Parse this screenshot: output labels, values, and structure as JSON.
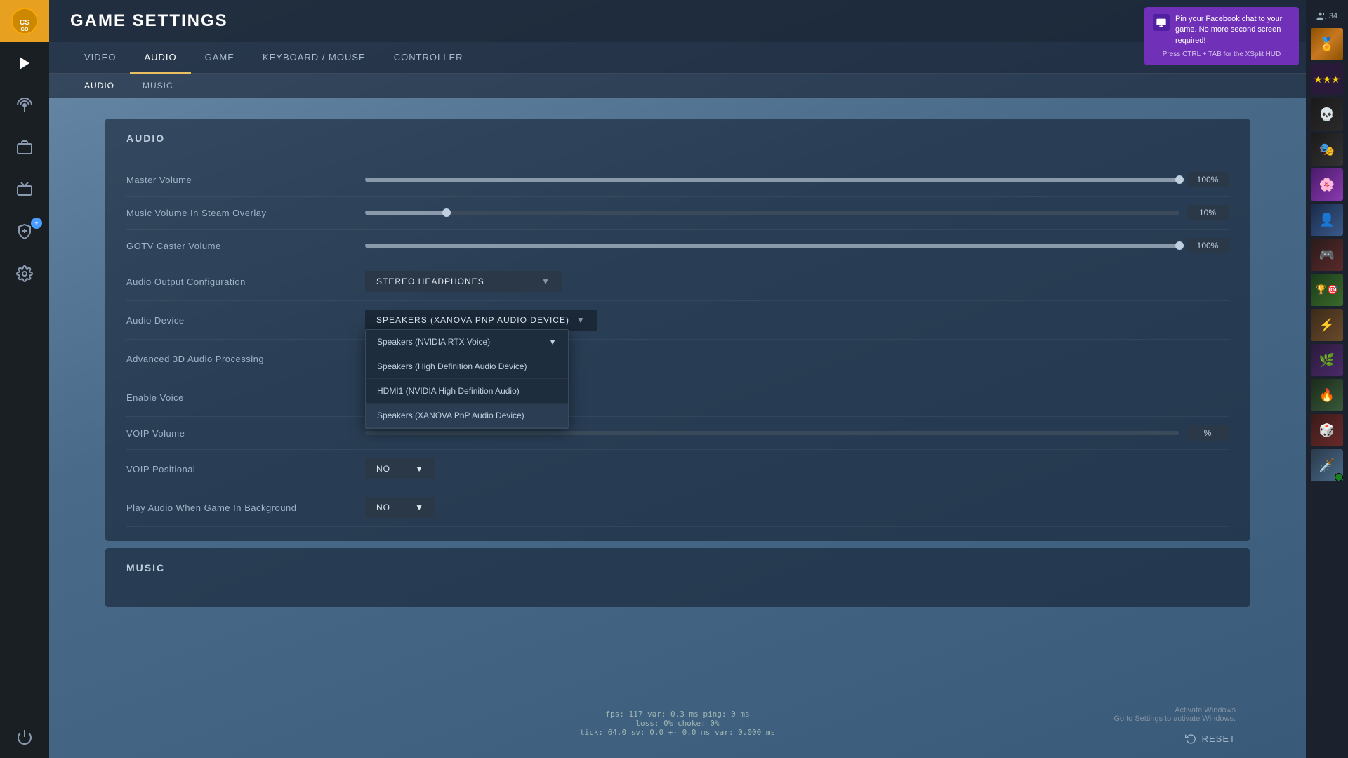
{
  "app": {
    "title": "GAME SETTINGS",
    "logo_text": "CS:GO"
  },
  "nav_tabs": [
    {
      "label": "Video",
      "active": false
    },
    {
      "label": "Audio",
      "active": true
    },
    {
      "label": "Game",
      "active": false
    },
    {
      "label": "Keyboard / Mouse",
      "active": false
    },
    {
      "label": "Controller",
      "active": false
    }
  ],
  "sub_tabs": [
    {
      "label": "Audio",
      "active": true
    },
    {
      "label": "Music",
      "active": false
    }
  ],
  "audio_section": {
    "title": "Audio",
    "settings": [
      {
        "label": "Master Volume",
        "type": "slider",
        "value": "100%",
        "fill_percent": 100
      },
      {
        "label": "Music Volume In Steam Overlay",
        "type": "slider",
        "value": "10%",
        "fill_percent": 10
      },
      {
        "label": "GOTV Caster Volume",
        "type": "slider",
        "value": "100%",
        "fill_percent": 100
      },
      {
        "label": "Audio Output Configuration",
        "type": "dropdown",
        "value": "STEREO HEADPHONES"
      },
      {
        "label": "Audio Device",
        "type": "dropdown",
        "value": "SPEAKERS (XANOVA PNP AUDIO DEVICE)",
        "open": true
      },
      {
        "label": "Advanced 3D Audio Processing",
        "type": "dropdown_inline",
        "value": ""
      },
      {
        "label": "Enable Voice",
        "type": "dropdown_inline",
        "value": ""
      },
      {
        "label": "VOIP Volume",
        "type": "slider_percent",
        "value": "%"
      },
      {
        "label": "VOIP Positional",
        "type": "select",
        "value": "NO"
      },
      {
        "label": "Play Audio When Game In Background",
        "type": "select",
        "value": "NO"
      }
    ]
  },
  "audio_device_dropdown": {
    "options": [
      {
        "label": "Speakers (NVIDIA RTX Voice)",
        "has_arrow": true
      },
      {
        "label": "Speakers (High Definition Audio Device)",
        "has_arrow": false
      },
      {
        "label": "HDMI1 (NVIDIA High Definition Audio)",
        "has_arrow": false
      },
      {
        "label": "Speakers (XANOVA PnP Audio Device)",
        "has_arrow": false
      }
    ]
  },
  "music_section": {
    "title": "Music"
  },
  "debug": {
    "line1": "fps: 117 var: 0.3 ms  ping: 0 ms",
    "line2": "loss:  0%  choke:  0%",
    "line3": "tick: 64.0  sv: 0.0 +-  0.0 ms  var: 0.000 ms"
  },
  "reset_button": {
    "label": "RESET"
  },
  "notification": {
    "title": "Pin your Facebook chat to your game. No more second screen required!",
    "footer": "Press CTRL + TAB for the XSplit HUD"
  },
  "activate_windows": {
    "line1": "Activate Windows",
    "line2": "Go to Settings to activate Windows."
  },
  "sidebar_icons": [
    {
      "name": "play-icon",
      "symbol": "▶"
    },
    {
      "name": "antenna-icon",
      "symbol": "📡"
    },
    {
      "name": "briefcase-icon",
      "symbol": "💼"
    },
    {
      "name": "tv-icon",
      "symbol": "📺"
    },
    {
      "name": "shield-plus-icon",
      "symbol": "🛡"
    },
    {
      "name": "settings-icon",
      "symbol": "⚙"
    },
    {
      "name": "power-icon",
      "symbol": "⏻"
    }
  ],
  "friends": {
    "count": "34",
    "avatars": [
      {
        "color": "gold",
        "label": "rank-gold"
      },
      {
        "color": "stars",
        "label": "stars"
      },
      {
        "color": "1",
        "emoji": "💀"
      },
      {
        "color": "2",
        "emoji": "🎭"
      },
      {
        "color": "3",
        "emoji": "🌸"
      },
      {
        "color": "4",
        "emoji": "👤"
      },
      {
        "color": "5",
        "emoji": "🎮"
      },
      {
        "color": "6",
        "emoji": "🏆"
      },
      {
        "color": "7",
        "emoji": "🎯"
      },
      {
        "color": "8",
        "emoji": "⚡"
      },
      {
        "color": "9",
        "emoji": "🌿"
      },
      {
        "color": "10",
        "emoji": "🔥"
      },
      {
        "color": "11",
        "emoji": "🎲"
      }
    ]
  }
}
